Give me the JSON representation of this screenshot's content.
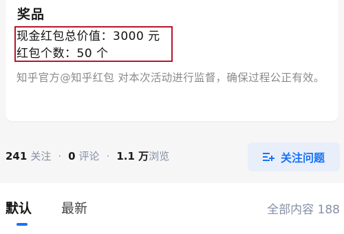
{
  "prize": {
    "title": "奖品",
    "cash_value": "现金红包总价值：3000 元",
    "count": "红包个数：50 个",
    "notice": "知乎官方@知乎红包 对本次活动进行监督，确保过程公正有效。"
  },
  "stats": {
    "followers_num": "241",
    "followers_label": "关注",
    "dot": "·",
    "comments_num": "0",
    "comments_label": "评论",
    "views_num": "1.1 万",
    "views_label": "浏览"
  },
  "follow_button": {
    "label": "关注问题",
    "icon": "add-follow-icon"
  },
  "tabs": [
    {
      "label": "默认",
      "active": true
    },
    {
      "label": "最新",
      "active": false
    }
  ],
  "all_content": "全部内容 188",
  "colors": {
    "accent": "#1772f6",
    "highlight_border": "#b5152b"
  }
}
